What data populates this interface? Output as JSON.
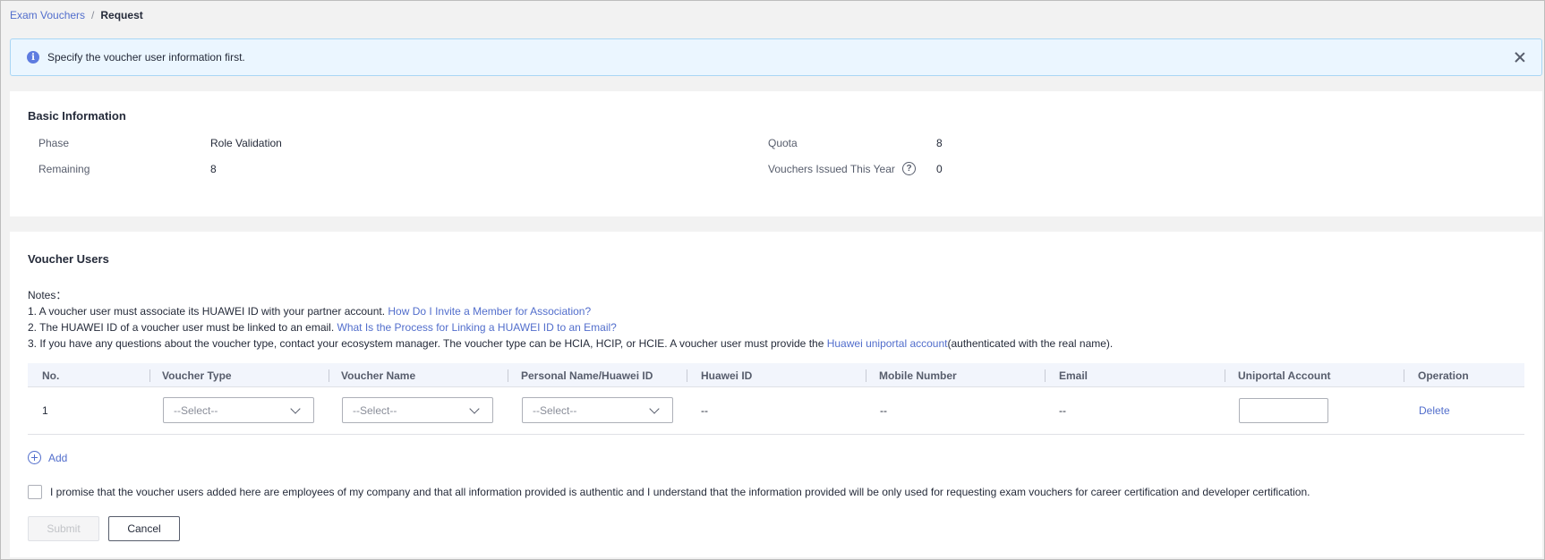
{
  "breadcrumb": {
    "parent": "Exam Vouchers",
    "separator": "/",
    "current": "Request"
  },
  "alert": {
    "icon": "info-icon",
    "message": "Specify the voucher user information first."
  },
  "basic_info": {
    "title": "Basic Information",
    "phase_label": "Phase",
    "phase_value": "Role Validation",
    "remaining_label": "Remaining",
    "remaining_value": "8",
    "quota_label": "Quota",
    "quota_value": "8",
    "issued_label": "Vouchers Issued This Year",
    "issued_value": "0"
  },
  "voucher_users": {
    "title": "Voucher Users",
    "notes_label": "Notes：",
    "notes": [
      {
        "text": "1. A voucher user must associate its HUAWEI ID with your partner account. ",
        "link": "How Do I Invite a Member for Association?",
        "after": ""
      },
      {
        "text": "2. The HUAWEI ID of a voucher user must be linked to an email. ",
        "link": "What Is the Process for Linking a HUAWEI ID to an Email?",
        "after": ""
      },
      {
        "text": "3. If you have any questions about the voucher type, contact your ecosystem manager. The voucher type can be HCIA, HCIP, or HCIE. A voucher user must provide the ",
        "link": "Huawei uniportal account",
        "after": "(authenticated with the real name)."
      }
    ],
    "columns": [
      "No.",
      "Voucher Type",
      "Voucher Name",
      "Personal Name/Huawei ID",
      "Huawei ID",
      "Mobile Number",
      "Email",
      "Uniportal Account",
      "Operation"
    ],
    "rows": [
      {
        "no": "1",
        "voucher_type": "--Select--",
        "voucher_name": "--Select--",
        "personal_name": "--Select--",
        "huawei_id": "--",
        "mobile": "--",
        "email": "--",
        "uniportal": "",
        "operation": "Delete"
      }
    ],
    "add_label": "Add",
    "promise_text": "I promise that the voucher users added here are employees of my company and that all information provided is authentic and I understand that the information provided will be only used for requesting exam vouchers for career certification and developer certification.",
    "submit_label": "Submit",
    "cancel_label": "Cancel"
  }
}
